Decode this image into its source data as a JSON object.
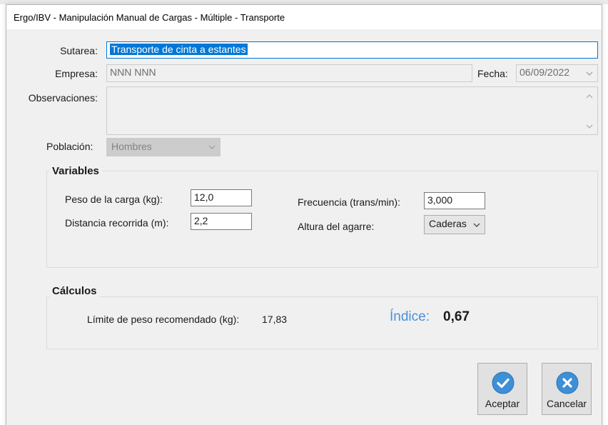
{
  "window": {
    "title": "Ergo/IBV - Manipulación Manual de Cargas - Múltiple - Transporte"
  },
  "form": {
    "subtarea_label": "Sutarea:",
    "subtarea_value": "Transporte de cinta a estantes",
    "empresa_label": "Empresa:",
    "empresa_value": "NNN NNN",
    "fecha_label": "Fecha:",
    "fecha_value": "06/09/2022",
    "observaciones_label": "Observaciones:",
    "observaciones_value": "",
    "poblacion_label": "Población:",
    "poblacion_value": "Hombres"
  },
  "variables": {
    "title": "Variables",
    "peso_label": "Peso de la carga (kg):",
    "peso_value": "12,0",
    "distancia_label": "Distancia recorrida (m):",
    "distancia_value": "2,2",
    "frecuencia_label": "Frecuencia (trans/min):",
    "frecuencia_value": "3,000",
    "altura_label": "Altura del agarre:",
    "altura_value": "Caderas"
  },
  "calculos": {
    "title": "Cálculos",
    "limite_label": "Límite de peso recomendado (kg):",
    "limite_value": "17,83",
    "indice_label": "Índice:",
    "indice_value": "0,67"
  },
  "buttons": {
    "aceptar_label": "Aceptar",
    "cancelar_label": "Cancelar"
  },
  "colors": {
    "accent": "#0078d7",
    "indice": "#4a90d9",
    "button_icon": "#3d8fd6"
  },
  "icons": {
    "aceptar": "check-circle-icon",
    "cancelar": "x-circle-icon"
  }
}
